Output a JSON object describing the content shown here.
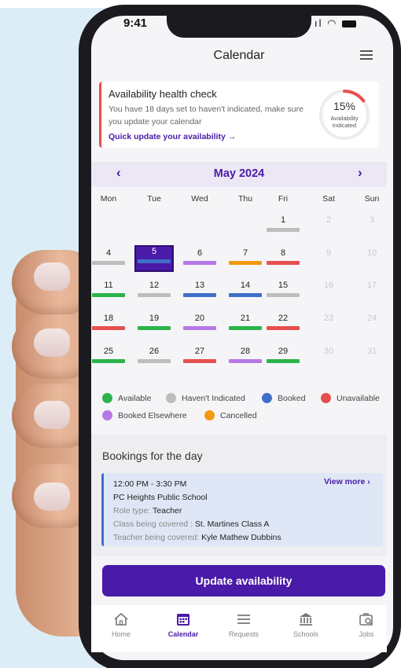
{
  "status": {
    "time": "9:41"
  },
  "header": {
    "title": "Calendar"
  },
  "health": {
    "title": "Availability health check",
    "message": "You have 18 days set to haven't indicated, make sure you update your calendar",
    "link": "Quick update your availability →",
    "percent": "15%",
    "percent_value": 0.15,
    "ring_label_1": "Availability",
    "ring_label_2": "Indicated"
  },
  "calendar": {
    "month": "May 2024",
    "prev": "‹",
    "next": "›",
    "weekdays": [
      "Mon",
      "Tue",
      "Wed",
      "Thu",
      "Fri",
      "Sat",
      "Sun"
    ],
    "days": [
      {
        "d": "1",
        "s": "gray"
      },
      {
        "d": "2",
        "s": "dim"
      },
      {
        "d": "3",
        "s": "dim"
      },
      {
        "d": "4",
        "s": "gray"
      },
      {
        "d": "5",
        "s": "blue"
      },
      {
        "d": "6",
        "s": "purple"
      },
      {
        "d": "7",
        "s": "orange"
      },
      {
        "d": "8",
        "s": "red"
      },
      {
        "d": "9",
        "s": "dim"
      },
      {
        "d": "10",
        "s": "dim"
      },
      {
        "d": "11",
        "s": "green"
      },
      {
        "d": "12",
        "s": "gray"
      },
      {
        "d": "13",
        "s": "blue"
      },
      {
        "d": "14",
        "s": "blue"
      },
      {
        "d": "15",
        "s": "gray"
      },
      {
        "d": "16",
        "s": "dim"
      },
      {
        "d": "17",
        "s": "dim"
      },
      {
        "d": "18",
        "s": "red"
      },
      {
        "d": "19",
        "s": "green"
      },
      {
        "d": "20",
        "s": "purple"
      },
      {
        "d": "21",
        "s": "green"
      },
      {
        "d": "22",
        "s": "red"
      },
      {
        "d": "23",
        "s": "dim"
      },
      {
        "d": "24",
        "s": "dim"
      },
      {
        "d": "25",
        "s": "green"
      },
      {
        "d": "26",
        "s": "gray"
      },
      {
        "d": "27",
        "s": "red"
      },
      {
        "d": "28",
        "s": "purple"
      },
      {
        "d": "29",
        "s": "green"
      },
      {
        "d": "30",
        "s": "dim"
      },
      {
        "d": "31",
        "s": "dim"
      }
    ],
    "selected_day": "5"
  },
  "legend": [
    {
      "label": "Available",
      "color": "#2bb34a"
    },
    {
      "label": "Haven't Indicated",
      "color": "#bdbdbd"
    },
    {
      "label": "Booked",
      "color": "#3f70c9"
    },
    {
      "label": "Unavailable",
      "color": "#e5504e"
    },
    {
      "label": "Booked Elsewhere",
      "color": "#b678e6"
    },
    {
      "label": "Cancelled",
      "color": "#f29a10"
    }
  ],
  "bookings": {
    "title": "Bookings for the day",
    "time": "12:00 PM - 3:30 PM",
    "school": "PC Heights Public School",
    "role_label": "Role type:",
    "role": "Teacher",
    "class_label": "Class being covered :",
    "class": "St. Martines Class A",
    "teacher_label": "Teacher being covered:",
    "teacher": "Kyle Mathew Dubbins",
    "view_more": "View more ›"
  },
  "update_button": "Update availability",
  "tabs": [
    {
      "label": "Home",
      "icon": "home-icon"
    },
    {
      "label": "Calendar",
      "icon": "calendar-icon",
      "active": true
    },
    {
      "label": "Requests",
      "icon": "list-icon"
    },
    {
      "label": "Schools",
      "icon": "school-icon"
    },
    {
      "label": "Jobs",
      "icon": "briefcase-search-icon"
    }
  ],
  "colors": {
    "accent": "#4a1aa8",
    "available": "#2bb34a",
    "not_indicated": "#bdbdbd",
    "booked": "#3f70c9",
    "unavailable": "#e5504e",
    "booked_elsewhere": "#b678e6",
    "cancelled": "#f29a10"
  }
}
